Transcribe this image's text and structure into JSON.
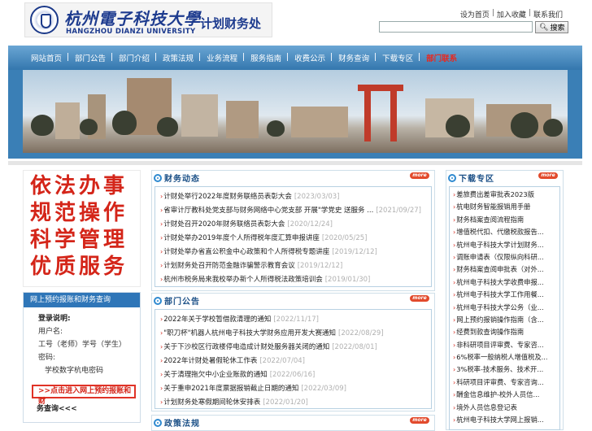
{
  "header": {
    "university_cn": "杭州電子科技大學",
    "university_en": "HANGZHOU DIANZI UNIVERSITY",
    "department": "计划财务处",
    "top_links": [
      "设为首页",
      "加入收藏",
      "联系我们"
    ],
    "search_placeholder": "",
    "search_label": "搜索"
  },
  "nav": [
    "网站首页",
    "部门公告",
    "部门介绍",
    "政策法规",
    "业务流程",
    "服务指南",
    "收费公示",
    "财务查询",
    "下载专区",
    "部门联系"
  ],
  "nav_highlight_index": 9,
  "calligraphy": [
    "依法办事",
    "规范操作",
    "科学管理",
    "优质服务"
  ],
  "login": {
    "title": "网上预约报账和财务查询",
    "intro": "登录说明:",
    "username_label": "用户名:",
    "username_hint": "工号（老师）学号（学生）",
    "password_label": "密码:",
    "password_hint": "学校数字杭电密码",
    "button": ">>点击进入网上预约报账和财",
    "button_tail": "务查询<<<"
  },
  "finance_news": {
    "title": "财务动态",
    "more": "more",
    "items": [
      {
        "text": "计财处举行2022年度财务联络员表彰大会",
        "date": "[2023/03/03]"
      },
      {
        "text": "省审计厅教科处党支部与财务网络中心党支部 开展\"学党史 送服务 ...",
        "date": "[2021/09/27]"
      },
      {
        "text": "计财处召开2020年财务联络员表彰大会",
        "date": "[2020/12/24]"
      },
      {
        "text": "计财处举办2019年度个人所得税年度汇算申报讲座",
        "date": "[2020/05/25]"
      },
      {
        "text": "计财处举办省直公积金中心政策和个人所得税专题讲座",
        "date": "[2019/12/12]"
      },
      {
        "text": "计划财务处召开防范金融诈骗警示教育会议",
        "date": "[2019/12/12]"
      },
      {
        "text": "杭州市税务局来我校举办新个人所得税法政策培训会",
        "date": "[2019/01/30]"
      }
    ]
  },
  "announcements": {
    "title": "部门公告",
    "more": "more",
    "items": [
      {
        "text": "2022年关于学校暂借款清理的通知",
        "date": "[2022/11/17]"
      },
      {
        "text": "\"职刀杯\"机器人杭州电子科技大学财务应用开发大赛通知",
        "date": "[2022/08/29]"
      },
      {
        "text": "关于下沙校区行政楼停电造成计财处服务器关闭的通知",
        "date": "[2022/08/01]"
      },
      {
        "text": "2022年计财处暑假轮休工作表",
        "date": "[2022/07/04]"
      },
      {
        "text": "关于清理拖欠中小企业账款的通知",
        "date": "[2022/06/16]"
      },
      {
        "text": "关于重申2021年度票据报销截止日期的通知",
        "date": "[2022/03/09]"
      },
      {
        "text": "计划财务处寒假期间轮休安排表",
        "date": "[2022/01/20]"
      }
    ]
  },
  "policy": {
    "title": "政策法规",
    "more": "more"
  },
  "downloads": {
    "title": "下载专区",
    "more": "more",
    "items": [
      "差旅费出差审批表2023版",
      "杭电财务智能报销用手册",
      "财务档案查阅流程指南",
      "增值税代扣、代缴税款报告...",
      "杭州电子科技大学计划财务...",
      "调账申请表（仅限纵向科研...",
      "财务档案查阅申批表（对外...",
      "杭州电子科技大学收费申报...",
      "杭州电子科技大学工作用餐...",
      "杭州电子科技大学公务（业...",
      "网上预约报销操作指南（含...",
      "经费到款查询操作指南",
      "非科研项目评审费、专家咨...",
      "6%税率一般纳税人增值税及...",
      "3%税率-技术服务、技术开...",
      "科研项目评审费、专家咨询...",
      "酬金信息维护-校外人员信...",
      "境外人员信息登记表",
      "杭州电子科技大学网上报销..."
    ]
  }
}
